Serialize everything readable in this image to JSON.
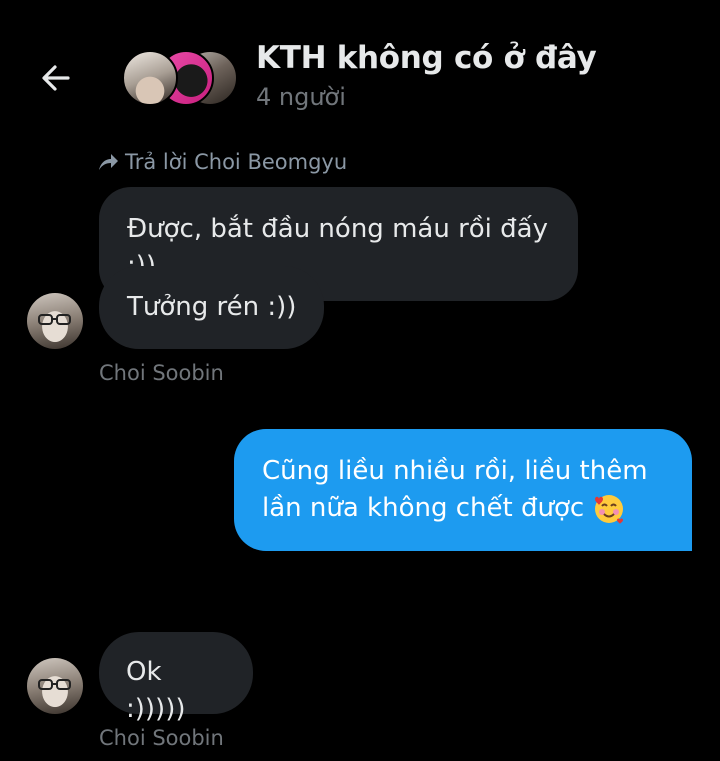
{
  "header": {
    "title": "KTH không có ở đây",
    "subtitle": "4 người",
    "back_icon": "arrow-left-icon"
  },
  "reply_context": {
    "text": "Trả lời Choi Beomgyu",
    "icon": "reply-arrow-icon"
  },
  "messages": [
    {
      "text": "Được, bắt đầu nóng máu rồi đấy :))",
      "direction": "incoming",
      "reply_preview": true
    },
    {
      "text": "Tưởng rén :))",
      "direction": "incoming",
      "sender": "Choi Soobin"
    },
    {
      "text_line1": "Cũng liều nhiều rồi, liều thêm",
      "text_line2": "lần nữa không chết được",
      "emoji": "smiling-face-with-hearts",
      "direction": "outgoing"
    },
    {
      "text": "Ok :)))))",
      "direction": "incoming",
      "sender": "Choi Soobin"
    }
  ],
  "colors": {
    "background": "#000000",
    "incoming_bubble": "#202327",
    "outgoing_bubble": "#1d9bf0",
    "secondary_text": "#71767b"
  }
}
